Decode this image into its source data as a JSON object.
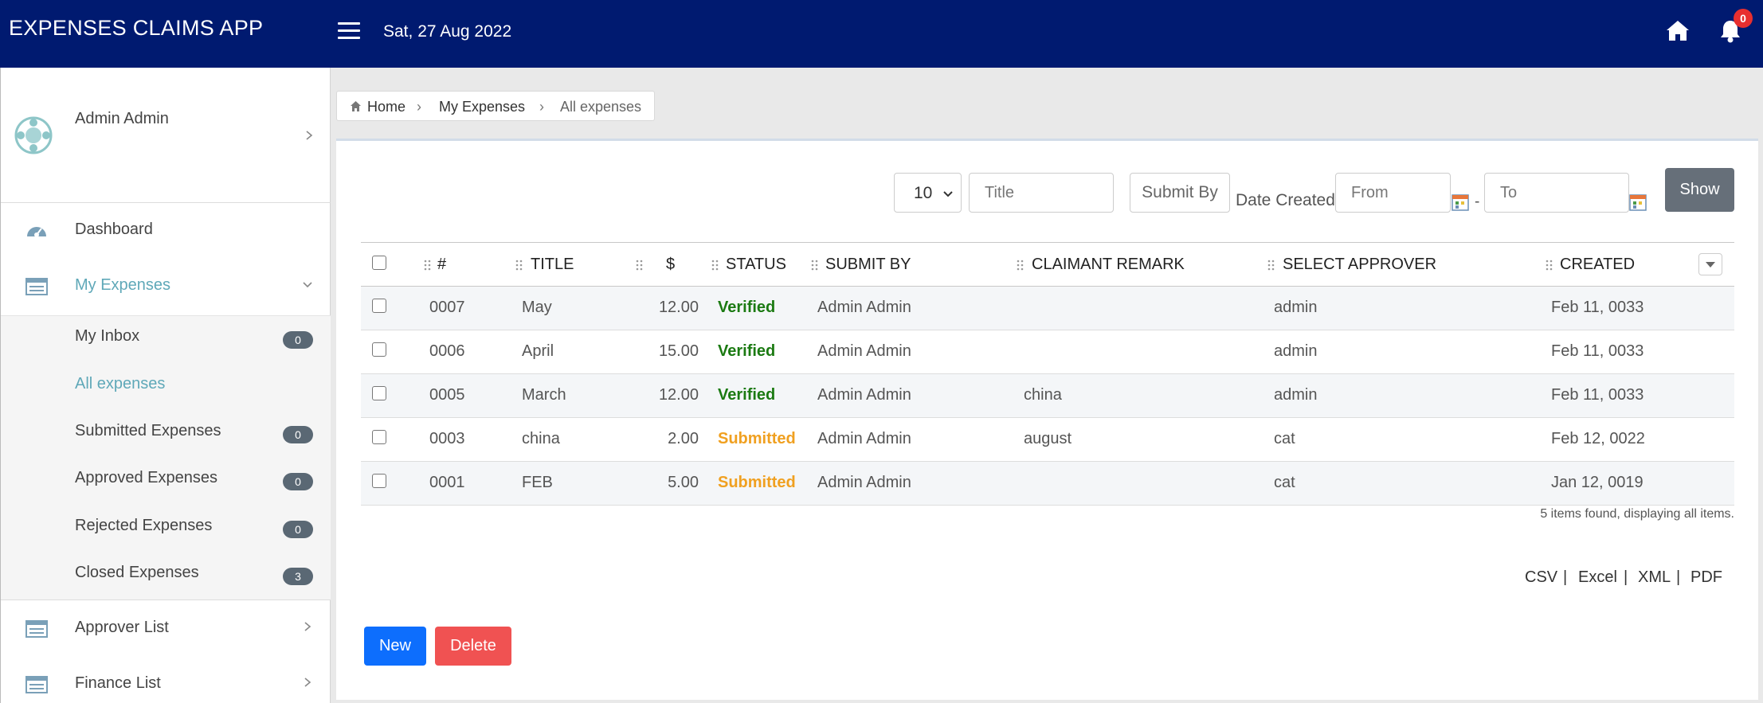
{
  "header": {
    "app_title": "EXPENSES CLAIMS APP",
    "date": "Sat, 27 Aug 2022",
    "notification_count": "0",
    "brand_color": "#001a70"
  },
  "sidebar": {
    "user_name": "Admin Admin",
    "items": [
      {
        "label": "Dashboard",
        "icon": "dashboard-icon"
      },
      {
        "label": "My Expenses",
        "icon": "list-icon",
        "expanded": true
      },
      {
        "label": "Approver List",
        "icon": "list-icon"
      },
      {
        "label": "Finance List",
        "icon": "list-icon"
      }
    ],
    "sub_items": [
      {
        "label": "My Inbox",
        "badge": "0"
      },
      {
        "label": "All expenses",
        "badge": null,
        "active": true
      },
      {
        "label": "Submitted Expenses",
        "badge": "0"
      },
      {
        "label": "Approved Expenses",
        "badge": "0"
      },
      {
        "label": "Rejected Expenses",
        "badge": "0"
      },
      {
        "label": "Closed Expenses",
        "badge": "3"
      }
    ]
  },
  "breadcrumb": [
    "Home",
    "My Expenses",
    "All expenses"
  ],
  "filters": {
    "page_size": "10",
    "title_placeholder": "Title",
    "submit_by": "Submit By",
    "date_created": "Date Created",
    "from_placeholder": "From",
    "dash": "-",
    "to_placeholder": "To",
    "show": "Show"
  },
  "table": {
    "columns": [
      "#",
      "TITLE",
      "$",
      "STATUS",
      "SUBMIT BY",
      "CLAIMANT REMARK",
      "SELECT APPROVER",
      "CREATED"
    ],
    "rows": [
      {
        "id": "0007",
        "title": "May",
        "amount": "12.00",
        "status": "Verified",
        "submit_by": "Admin Admin",
        "remark": "",
        "approver": "admin",
        "created": "Feb 11, 0033"
      },
      {
        "id": "0006",
        "title": "April",
        "amount": "15.00",
        "status": "Verified",
        "submit_by": "Admin Admin",
        "remark": "",
        "approver": "admin",
        "created": "Feb 11, 0033"
      },
      {
        "id": "0005",
        "title": "March",
        "amount": "12.00",
        "status": "Verified",
        "submit_by": "Admin Admin",
        "remark": "china",
        "approver": "admin",
        "created": "Feb 11, 0033"
      },
      {
        "id": "0003",
        "title": "china",
        "amount": "2.00",
        "status": "Submitted",
        "submit_by": "Admin Admin",
        "remark": "august",
        "approver": "cat",
        "created": "Feb 12, 0022"
      },
      {
        "id": "0001",
        "title": "FEB",
        "amount": "5.00",
        "status": "Submitted",
        "submit_by": "Admin Admin",
        "remark": "",
        "approver": "cat",
        "created": "Jan 12, 0019"
      }
    ],
    "items_found": "5 items found, displaying all items."
  },
  "exports": [
    "CSV",
    "Excel",
    "XML",
    "PDF"
  ],
  "buttons": {
    "new": "New",
    "delete": "Delete"
  },
  "colors": {
    "verified": "#1b7a12",
    "submitted": "#f0a020",
    "accent": "#5fa8b8"
  }
}
